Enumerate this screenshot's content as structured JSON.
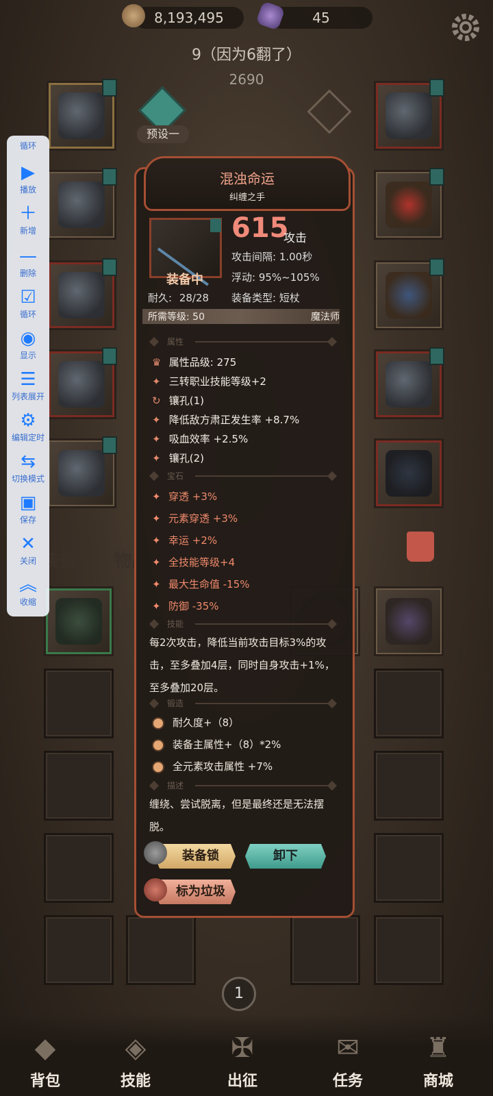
{
  "top": {
    "gold": "8,193,495",
    "gems": "45"
  },
  "banner": {
    "title": "9（因为6翻了）",
    "score": "2690",
    "preset": "预设一"
  },
  "toolbar": {
    "items": [
      {
        "label": "循环",
        "icon": "loop-icon"
      },
      {
        "label": "播放",
        "icon": "play-icon"
      },
      {
        "label": "新增",
        "icon": "plus-icon"
      },
      {
        "label": "删除",
        "icon": "minus-icon"
      },
      {
        "label": "循环",
        "icon": "checkbox-icon"
      },
      {
        "label": "显示",
        "icon": "eye-icon"
      },
      {
        "label": "列表展开",
        "icon": "list-expand-icon"
      },
      {
        "label": "编辑定时",
        "icon": "gear-icon"
      },
      {
        "label": "切换模式",
        "icon": "swap-icon"
      },
      {
        "label": "保存",
        "icon": "save-icon"
      },
      {
        "label": "关闭",
        "icon": "close-icon"
      },
      {
        "label": "收缩",
        "icon": "collapse-icon"
      }
    ]
  },
  "tabs": {
    "equip": "装备",
    "items": "物品"
  },
  "item": {
    "name": "混浊命运",
    "subtitle": "纠缠之手",
    "status": "装备中",
    "durability_label": "耐久:",
    "durability": "28/28",
    "attack": "615",
    "attack_unit": "攻击",
    "interval": "攻击间隔: 1.00秒",
    "float": "浮动: 95%~105%",
    "type": "装备类型: 短杖",
    "req_level": "所需等级: 50",
    "req_class": "魔法师",
    "sections": {
      "attr": "属性",
      "gem": "宝石",
      "skill": "技能",
      "forge": "锻造",
      "desc": "描述"
    },
    "attributes": [
      "属性品级: 275",
      "三转职业技能等级+2",
      "镶孔(1)",
      "降低敌方肃正发生率 +8.7%",
      "吸血效率 +2.5%",
      "镶孔(2)"
    ],
    "gems": [
      "穿透 +3%",
      "元素穿透 +3%",
      "幸运 +2%",
      "全技能等级+4",
      "最大生命值 -15%",
      "防御 -35%"
    ],
    "skill_text": "每2次攻击，降低当前攻击目标3%的攻击，至多叠加4层，同时自身攻击+1%，至多叠加20层。",
    "forge": [
      "耐久度+（8）",
      "装备主属性+（8）*2%",
      "全元素攻击属性 +7%"
    ],
    "description": "缠绕、尝试脱离，但是最终还是无法摆脱。",
    "buttons": {
      "lock": "装备锁",
      "unload": "卸下",
      "trash": "标为垃圾"
    }
  },
  "page_indicator": "1",
  "nav": [
    {
      "label": "背包",
      "icon": "backpack-icon"
    },
    {
      "label": "技能",
      "icon": "skill-icon"
    },
    {
      "label": "出征",
      "icon": "battle-icon"
    },
    {
      "label": "任务",
      "icon": "quest-icon"
    },
    {
      "label": "商城",
      "icon": "shop-icon"
    }
  ]
}
